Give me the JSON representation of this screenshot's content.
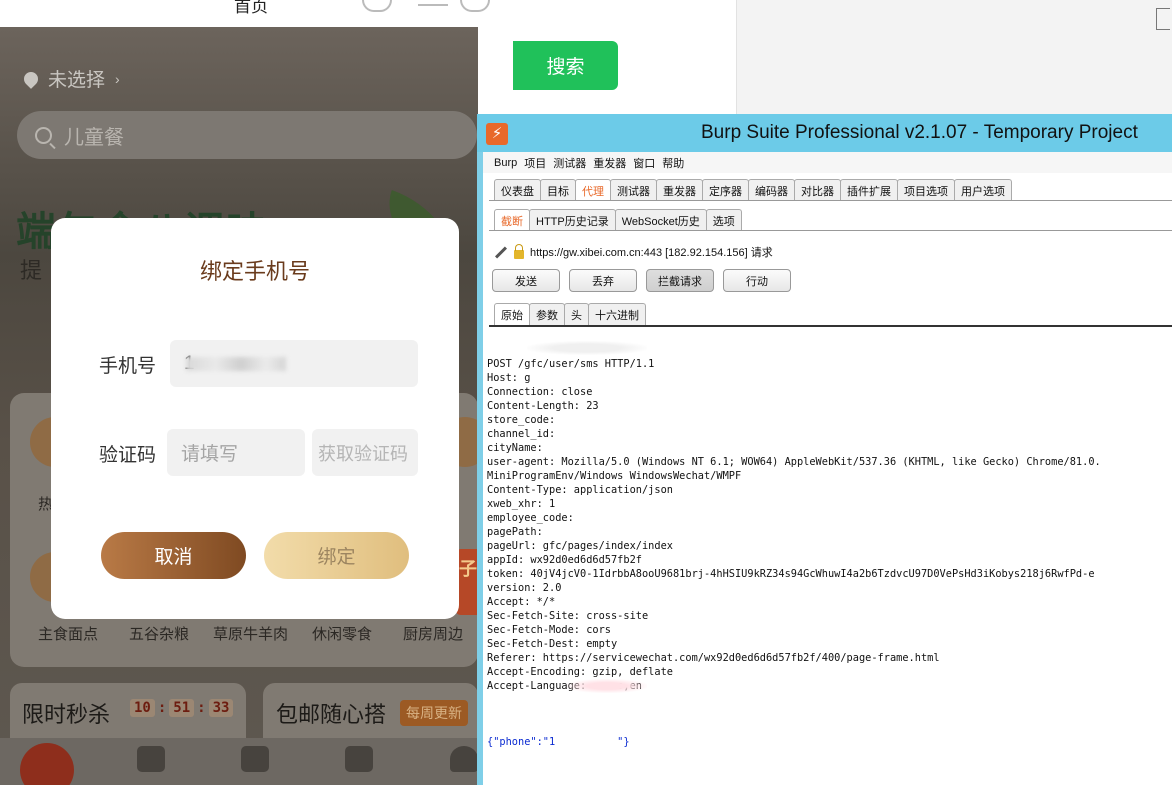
{
  "phone_header": {
    "title": "首页"
  },
  "search_button": {
    "label": "搜索"
  },
  "app": {
    "location": "未选择",
    "search_placeholder": "儿童餐",
    "banner_title": "端午食八调味",
    "banner_sub": "提",
    "partial_label_left": "热",
    "categories": [
      "主食面点",
      "五谷杂粮",
      "草原牛羊肉",
      "休闲零食",
      "厨房周边"
    ],
    "side_badge": "子",
    "promo_flash": "限时秒杀",
    "timer": [
      "10",
      "51",
      "33"
    ],
    "promo_free": "包邮随心搭",
    "weekly_badge": "每周更新"
  },
  "modal": {
    "title": "绑定手机号",
    "phone_label": "手机号",
    "phone_value": "1",
    "code_label": "验证码",
    "code_placeholder": "请填写",
    "get_code_label": "获取验证码",
    "cancel_label": "取消",
    "bind_label": "绑定"
  },
  "burp": {
    "title": "Burp Suite Professional v2.1.07 - Temporary Project",
    "menu": [
      "Burp",
      "项目",
      "测试器",
      "重发器",
      "窗口",
      "帮助"
    ],
    "main_tabs": [
      "仪表盘",
      "目标",
      "代理",
      "测试器",
      "重发器",
      "定序器",
      "编码器",
      "对比器",
      "插件扩展",
      "项目选项",
      "用户选项"
    ],
    "sub_tabs": [
      "截断",
      "HTTP历史记录",
      "WebSocket历史",
      "选项"
    ],
    "request_info": "https://gw.xibei.com.cn:443  [182.92.154.156] 请求",
    "buttons": [
      "发送",
      "丢弃",
      "拦截请求",
      "行动"
    ],
    "view_tabs": [
      "原始",
      "参数",
      "头",
      "十六进制"
    ],
    "request_lines": [
      "POST /gfc/user/sms HTTP/1.1",
      "Host: g",
      "Connection: close",
      "Content-Length: 23",
      "store_code:",
      "channel_id:",
      "cityName:",
      "user-agent: Mozilla/5.0 (Windows NT 6.1; WOW64) AppleWebKit/537.36 (KHTML, like Gecko) Chrome/81.0.",
      "MiniProgramEnv/Windows WindowsWechat/WMPF",
      "Content-Type: application/json",
      "xweb_xhr: 1",
      "employee_code:",
      "pagePath:",
      "pageUrl: gfc/pages/index/index",
      "appId: wx92d0ed6d6d57fb2f",
      "token: 40jV4jcV0-1IdrbbA8ooU9681brj-4hHSIU9kRZ34s94GcWhuwI4a2b6TzdvcU97D0VePsHd3iKobys218j6RwfPd-e",
      "version: 2.0",
      "Accept: */*",
      "Sec-Fetch-Site: cross-site",
      "Sec-Fetch-Mode: cors",
      "Sec-Fetch-Dest: empty",
      "Referer: https://servicewechat.com/wx92d0ed6d6d57fb2f/400/page-frame.html",
      "Accept-Encoding: gzip, deflate",
      "Accept-Language: en-us,en",
      ""
    ],
    "body_line": "{\"phone\":\"1          \"}"
  },
  "colors": {
    "search_green": "#20c15a",
    "burp_title_blue": "#6ccbe8",
    "burp_orange": "#e8692a",
    "modal_brown": "#6a3b1c",
    "json_blue": "#0b2bd1"
  }
}
